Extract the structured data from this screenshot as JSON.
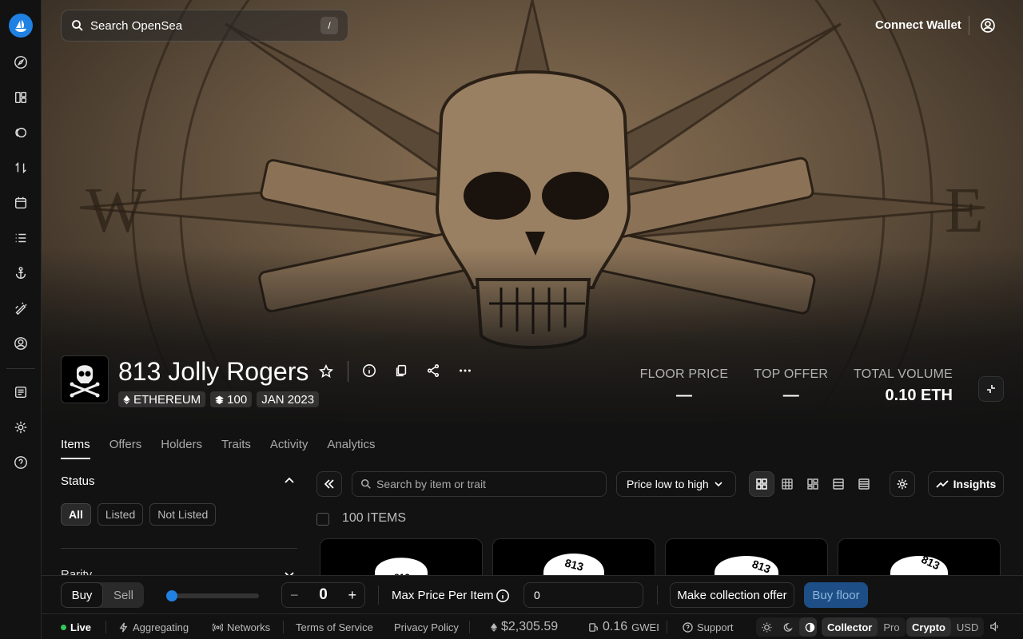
{
  "search": {
    "placeholder": "Search OpenSea",
    "shortcut": "/"
  },
  "header": {
    "connect_wallet": "Connect Wallet"
  },
  "collection": {
    "name": "813 Jolly Rogers",
    "chain": "ETHEREUM",
    "items_count": "100",
    "created": "JAN 2023"
  },
  "stats": [
    {
      "label": "FLOOR PRICE",
      "value": "—"
    },
    {
      "label": "TOP OFFER",
      "value": "—"
    },
    {
      "label": "TOTAL VOLUME",
      "value": "0.10 ETH"
    }
  ],
  "tabs": [
    "Items",
    "Offers",
    "Holders",
    "Traits",
    "Activity",
    "Analytics"
  ],
  "filters": {
    "status_title": "Status",
    "status_options": [
      "All",
      "Listed",
      "Not Listed"
    ],
    "rarity_title": "Rarity"
  },
  "toolbar": {
    "item_search_placeholder": "Search by item or trait",
    "sort_label": "Price low to high",
    "insights_label": "Insights",
    "items_count_label": "100 ITEMS"
  },
  "card_text": "813",
  "buybar": {
    "buy": "Buy",
    "sell": "Sell",
    "quantity": "0",
    "max_price_label": "Max Price Per Item",
    "max_price_value": "0",
    "collection_offer": "Make collection offer",
    "buy_floor": "Buy floor"
  },
  "footer": {
    "live": "Live",
    "aggregating": "Aggregating",
    "networks": "Networks",
    "terms": "Terms of Service",
    "privacy": "Privacy Policy",
    "eth_price": "$2,305.59",
    "gas": "0.16",
    "gas_unit": "GWEI",
    "support": "Support",
    "collector": "Collector",
    "pro": "Pro",
    "crypto": "Crypto",
    "usd": "USD"
  },
  "colors": {
    "accent": "#2081e2",
    "live": "#34c759",
    "background": "#121212"
  }
}
